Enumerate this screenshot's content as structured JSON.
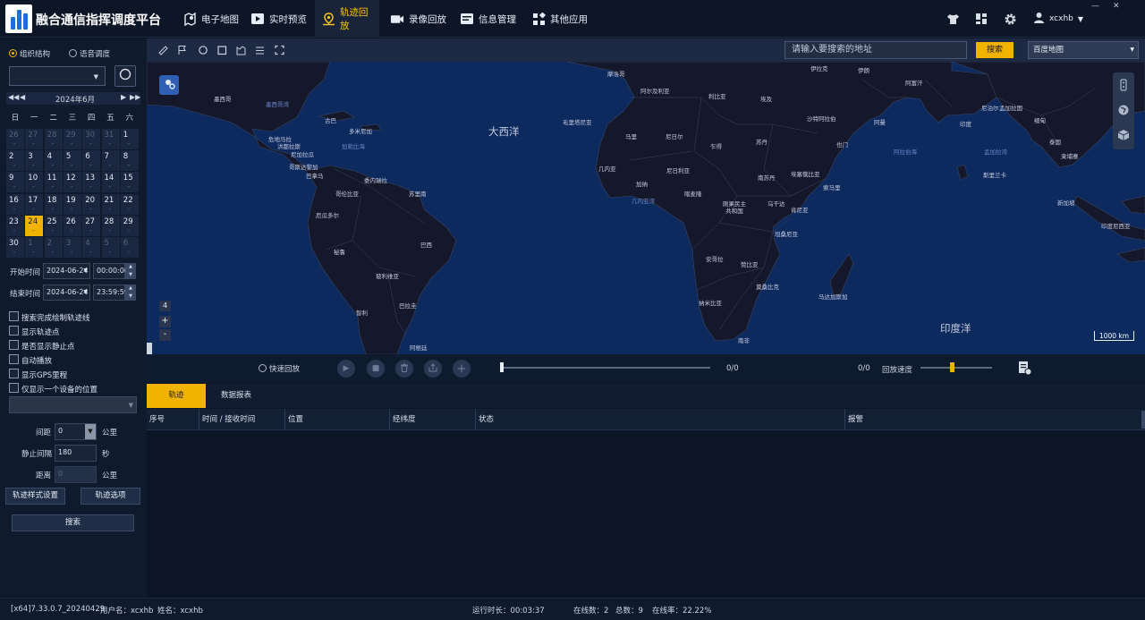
{
  "app": {
    "title": "融合通信指挥调度平台"
  },
  "nav": [
    {
      "label": "电子地图",
      "icon": "map-pin-icon"
    },
    {
      "label": "实时预览",
      "icon": "video-play-icon"
    },
    {
      "label": "轨迹回放",
      "icon": "track-pin-icon",
      "active": true
    },
    {
      "label": "录像回放",
      "icon": "camera-icon"
    },
    {
      "label": "信息管理",
      "icon": "info-card-icon"
    },
    {
      "label": "其他应用",
      "icon": "apps-grid-icon"
    }
  ],
  "user": {
    "name": "xcxhb"
  },
  "window": {
    "minimize": "—",
    "close": "✕"
  },
  "left": {
    "mode": {
      "org": "组织结构",
      "voice": "语音调度",
      "selected": "组织结构"
    },
    "calendar": {
      "month_label": "2024年6月",
      "weekdays": [
        "日",
        "一",
        "二",
        "三",
        "四",
        "五",
        "六"
      ],
      "weeks": [
        [
          "26",
          "27",
          "28",
          "29",
          "30",
          "31",
          "1"
        ],
        [
          "2",
          "3",
          "4",
          "5",
          "6",
          "7",
          "8"
        ],
        [
          "9",
          "10",
          "11",
          "12",
          "13",
          "14",
          "15"
        ],
        [
          "16",
          "17",
          "18",
          "19",
          "20",
          "21",
          "22"
        ],
        [
          "23",
          "24",
          "25",
          "26",
          "27",
          "28",
          "29"
        ],
        [
          "30",
          "1",
          "2",
          "3",
          "4",
          "5",
          "6"
        ]
      ],
      "selected": "24"
    },
    "start": {
      "label": "开始时间",
      "date": "2024-06-24",
      "time": "00:00:00"
    },
    "end": {
      "label": "结束时间",
      "date": "2024-06-24",
      "time": "23:59:59"
    },
    "options": [
      "搜索完成绘制轨迹线",
      "显示轨迹点",
      "是否显示静止点",
      "自动播放",
      "显示GPS里程",
      "仅显示一个设备的位置"
    ],
    "interval": {
      "label": "间距",
      "value": "0",
      "unit": "公里"
    },
    "stop_interval": {
      "label": "静止间隔",
      "value": "180",
      "unit": "秒"
    },
    "distance": {
      "label": "距离",
      "value": "0",
      "unit": "公里"
    },
    "buttons": {
      "style": "轨迹样式设置",
      "options": "轨迹选项",
      "search": "搜索"
    }
  },
  "map": {
    "search_placeholder": "请输入要搜索的地址",
    "search_button": "搜索",
    "map_type": "百度地图",
    "zoom_level": "4",
    "zoom_in": "+",
    "zoom_out": "-",
    "scale": "1000 km",
    "labels": {
      "atlantic": "大西洋",
      "indian": "印度洋",
      "mexico": "墨西哥",
      "gulf": "墨西哥湾",
      "cuba": "古巴",
      "dominica": "多米尼加",
      "caribbean": "加勒比海",
      "guatemala": "危地马拉",
      "honduras": "洪都拉斯",
      "nicaragua": "尼加拉瓜",
      "costa_rica": "哥斯达黎加",
      "panama": "巴拿马",
      "venezuela": "委内瑞拉",
      "colombia": "哥伦比亚",
      "suriname": "苏里南",
      "ecuador": "厄瓜多尔",
      "peru": "秘鲁",
      "brazil": "巴西",
      "bolivia": "玻利维亚",
      "chile": "智利",
      "paraguay": "巴拉圭",
      "argentina": "阿根廷",
      "morocco": "摩洛哥",
      "algeria": "阿尔及利亚",
      "libya": "利比亚",
      "egypt": "埃及",
      "saudi": "沙特阿拉伯",
      "iraq": "伊拉克",
      "iran": "伊朗",
      "afghanistan": "阿富汗",
      "pakistan": "巴基斯坦",
      "india": "印度",
      "nepal": "尼泊尔",
      "bangladesh": "孟加拉国",
      "myanmar": "缅甸",
      "thailand": "泰国",
      "cambodia": "柬埔寨",
      "sri_lanka": "斯里兰卡",
      "singapore": "新加坡",
      "indonesia": "印度尼西亚",
      "mauritania": "毛里塔尼亚",
      "mali": "马里",
      "niger": "尼日尔",
      "chad": "乍得",
      "sudan": "苏丹",
      "oman": "阿曼",
      "yemen": "也门",
      "arabian_sea": "阿拉伯海",
      "bay_bengal": "孟加拉湾",
      "guinea": "几内亚",
      "ghana": "加纳",
      "nigeria": "尼日利亚",
      "cameroon": "喀麦隆",
      "ethiopia": "埃塞俄比亚",
      "somalia": "索马里",
      "south_sudan": "南苏丹",
      "gulf_guinea": "几内亚湾",
      "drc": "刚果民主\n共和国",
      "uganda": "乌干达",
      "kenya": "肯尼亚",
      "tanzania": "坦桑尼亚",
      "angola": "安哥拉",
      "zambia": "赞比亚",
      "mozambique": "莫桑比克",
      "namibia": "纳米比亚",
      "madagascar": "马达加斯加",
      "south_africa": "南非"
    }
  },
  "playback": {
    "fast_label": "快速回放",
    "progress_left": "0/0",
    "progress_right": "0/0",
    "speed_label": "回放速度"
  },
  "tabs": [
    "轨迹",
    "数据报表"
  ],
  "table": {
    "columns": [
      "序号",
      "时间 / 接收时间",
      "位置",
      "经纬度",
      "状态",
      "报警"
    ]
  },
  "status": {
    "version": "[x64]7.33.0.7_20240429",
    "username": "用户名：xcxhb",
    "name": "姓名：xcxhb",
    "runtime": "运行时长：00:03:37",
    "online": "在线数：2",
    "total": "总数：9",
    "rate": "在线率：22.22%"
  }
}
